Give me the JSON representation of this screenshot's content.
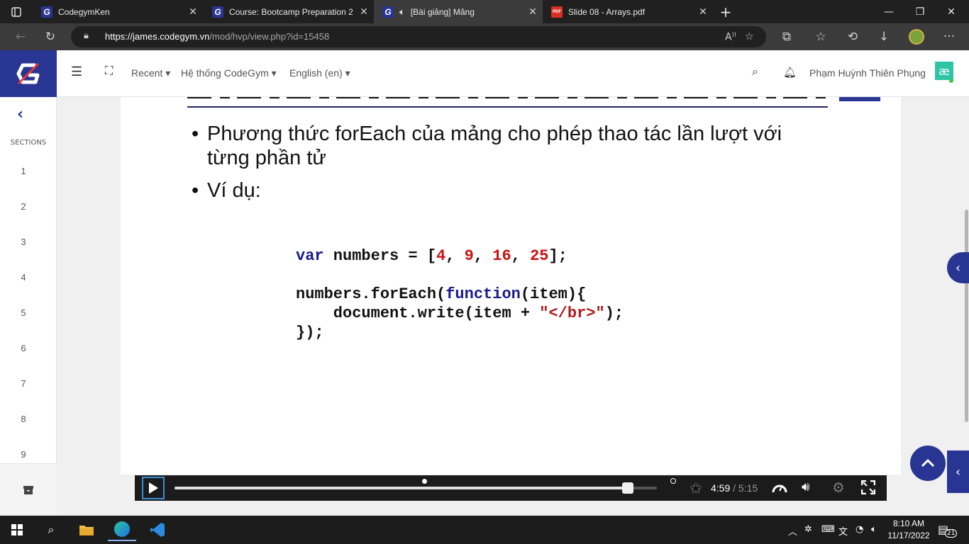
{
  "browser": {
    "tabs": [
      {
        "title": "CodegymKen",
        "icon": "codegym-favicon"
      },
      {
        "title": "Course: Bootcamp Preparation 2",
        "icon": "codegym-favicon"
      },
      {
        "title": "[Bài giảng] Mảng",
        "icon": "codegym-favicon",
        "active": true,
        "audio": true
      },
      {
        "title": "Slide 08 - Arrays.pdf",
        "icon": "pdf-favicon"
      }
    ],
    "url_domain": "https://james.codegym.vn",
    "url_path": "/mod/hvp/view.php?id=15458",
    "pdf_label": "PDF"
  },
  "header": {
    "logo_letter": "G",
    "menu_recent": "Recent",
    "menu_system": "Hệ thống CodeGym",
    "menu_lang": "English (en)",
    "user_name": "Phạm Huỳnh Thiên Phụng",
    "avatar_text": "æ"
  },
  "sidebar": {
    "sections_label": "SECTIONS",
    "sections": [
      "1",
      "2",
      "3",
      "4",
      "5",
      "6",
      "7",
      "8",
      "9"
    ]
  },
  "slide": {
    "bullet1_line1": "Phương thức forEach của mảng cho phép thao tác lần lượt với",
    "bullet1_line2": "từng phần tử",
    "bullet2": "Ví dụ:",
    "code": {
      "l1_kw": "var",
      "l1_mid": " numbers = [",
      "nums": [
        "4",
        "9",
        "16",
        "25"
      ],
      "l1_end": "];",
      "l2_pre": "numbers.forEach(",
      "l2_kw": "function",
      "l2_post": "(item){",
      "l3_pre": "    document.write(item + ",
      "l3_str": "\"</br>\"",
      "l3_post": ");",
      "l4": "});"
    }
  },
  "video": {
    "time_current": "4:59",
    "time_sep": " / ",
    "time_total": "5:15",
    "progress": 0.939
  },
  "taskbar": {
    "time": "8:10 AM",
    "date": "11/17/2022",
    "notif_count": "21"
  },
  "colors": {
    "brand": "#283593",
    "code_keyword": "#1a1a8c",
    "code_number": "#cc1111"
  }
}
